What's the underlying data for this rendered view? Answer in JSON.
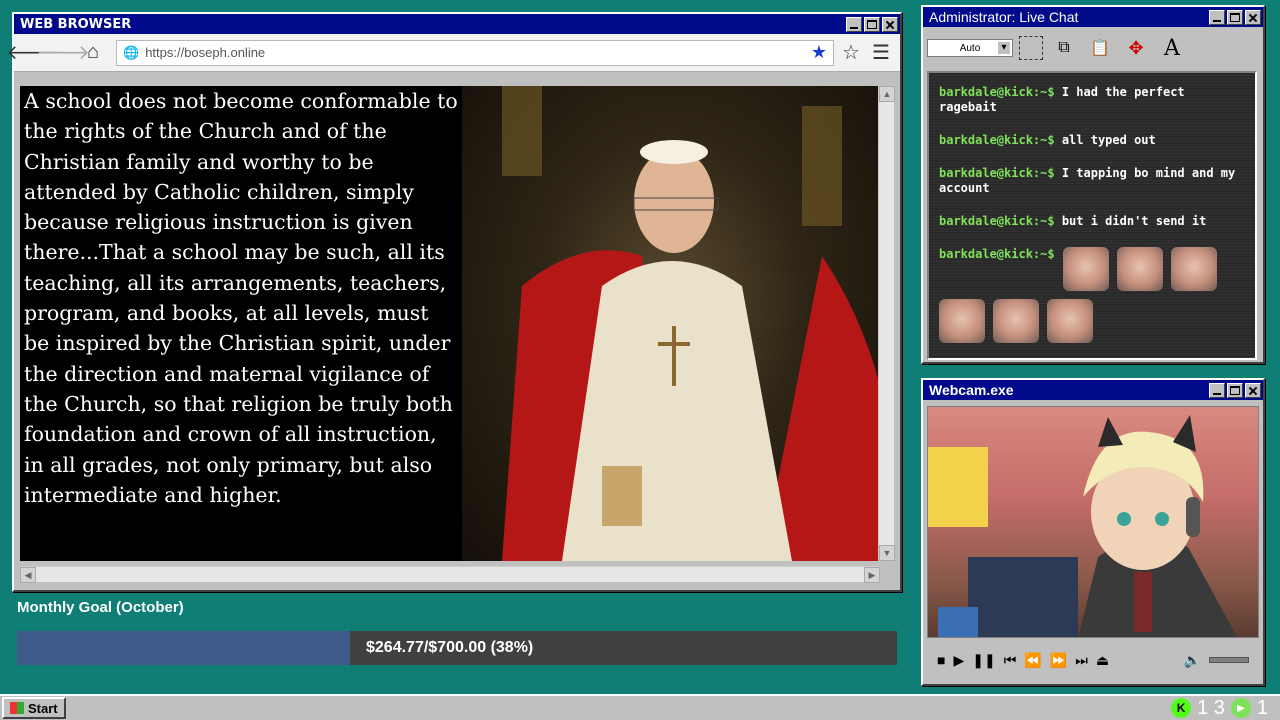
{
  "browser": {
    "title": "WEB BROWSER",
    "url": "https://boseph.online",
    "quote_text": "A school does not become conformable to the rights of the Church and of the Christian family and worthy to be attended by Catholic children, simply because religious instruction is given there...That a school may be such, all its teaching, all its arrangements, teachers, program, and books, at all levels, must be inspired by the Christian spirit, under the direction and maternal vigilance of the Church, so that religion be truly both foundation and crown of all instruction, in all grades, not only primary, but also intermediate and higher."
  },
  "chat": {
    "title": "Administrator: Live Chat",
    "size_select": "Auto",
    "messages": [
      {
        "user": "barkdale@kick:~$",
        "text": "I had the perfect ragebait"
      },
      {
        "user": "barkdale@kick:~$",
        "text": "all typed out"
      },
      {
        "user": "barkdale@kick:~$",
        "text": "I tapping bo mind and my account"
      },
      {
        "user": "barkdale@kick:~$",
        "text": "but i didn't send it"
      },
      {
        "user": "barkdale@kick:~$",
        "text": ""
      }
    ],
    "emote_icon": "crying-face-emote"
  },
  "webcam": {
    "title": "Webcam.exe"
  },
  "goal": {
    "label": "Monthly Goal (October)",
    "text": "$264.77/$700.00 (38%)",
    "progress": 0.378
  },
  "taskbar": {
    "start_label": "Start",
    "kick_count": "1 3",
    "play_count": "1"
  },
  "colors": {
    "desktop": "#0f7f75",
    "titlebar": "#000a8a",
    "chat_user": "#7fe15a",
    "goal_fill": "#3d5a8a",
    "kick_green": "#53fc18"
  }
}
